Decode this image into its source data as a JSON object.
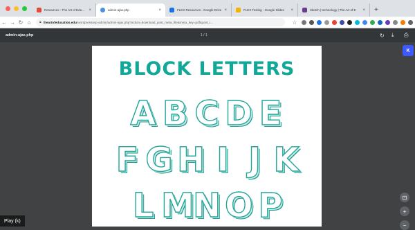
{
  "tabs": [
    {
      "title": "Resources - The Art of Education U",
      "color": "#e24b3b",
      "active": false
    },
    {
      "title": "admin-ajax.php",
      "color": "#4a90e2",
      "active": true
    },
    {
      "title": "FLEX Resources - Google Drive",
      "color": "#1a73e8",
      "active": false
    },
    {
      "title": "FLEX Testing - Google Slides",
      "color": "#f4b400",
      "active": false
    },
    {
      "title": "Sketch | technology | The Art of E",
      "color": "#6a3c8c",
      "active": false
    }
  ],
  "address": {
    "host": "theartofeducation.edu",
    "path": "/wordpress/wp-admin/admin-ajax.php?action=download_post_meta_file&meta_key=pdf&post_i..."
  },
  "pdf": {
    "title": "admin-ajax.php",
    "pages": "1 / 1",
    "k_label": "K"
  },
  "document": {
    "heading": "BLOCK LETTERS",
    "rows": [
      [
        "A",
        "B",
        "C",
        "D",
        "E"
      ],
      [
        "F",
        "G",
        "H",
        "I",
        "J",
        "K"
      ],
      [
        "L",
        "M",
        "N",
        "O",
        "P"
      ]
    ]
  },
  "player": {
    "play_label": "Play (k)"
  },
  "colors": {
    "accent": "#12a898",
    "viewer_bg": "#404244"
  }
}
